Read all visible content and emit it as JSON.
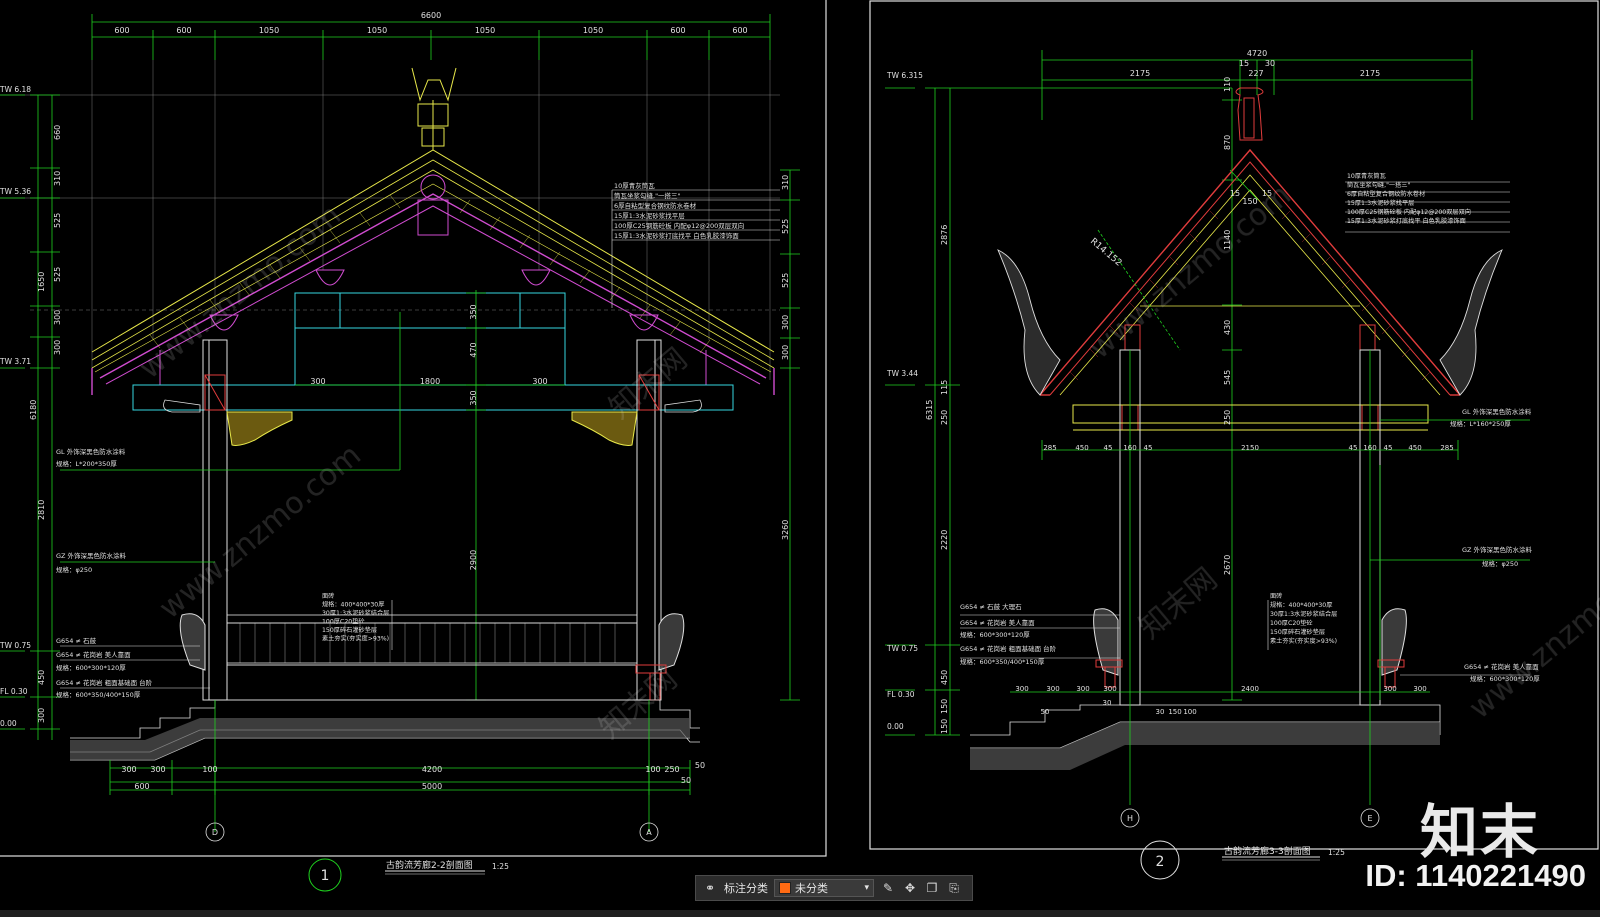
{
  "drawing_1": {
    "title": "古韵流芳廊2-2剖面图",
    "scale": "1:25",
    "number": "1",
    "top_dims": [
      "600",
      "600",
      "1050",
      "1050",
      "1050",
      "1050",
      "600",
      "600"
    ],
    "overall_top": "6600",
    "levels": [
      "TW 6.18",
      "TW 5.36",
      "TW 3.71",
      "TW 0.75",
      "FL 0.30",
      "0.00"
    ],
    "left_dims": [
      "660",
      "310",
      "525",
      "525",
      "300",
      "300",
      "1650",
      "6180",
      "2810",
      "450",
      "300"
    ],
    "right_dims": [
      "310",
      "525",
      "525",
      "300",
      "300",
      "3260"
    ],
    "inner_dims": [
      "300",
      "1800",
      "300",
      "350",
      "470",
      "350",
      "2900"
    ],
    "bottom_dims": [
      "300",
      "300",
      "100",
      "4200",
      "100",
      "250",
      "50",
      "600",
      "5000",
      "50"
    ],
    "grid_left": "D",
    "grid_right": "A",
    "note_roof": [
      "10厚青灰筒瓦",
      "筒瓦坐浆勾缝,\"一搭三\"",
      "6厚自粘型复合钢纹防水卷材",
      "15厚1:3水泥砂浆找平层",
      "100厚C25钢筋砼板  内配φ12@200双层双向",
      "15厚1:3水泥砂浆打底找平  白色乳胶漆饰面"
    ],
    "note_gl": [
      "GL  外饰深黑色防水涂料",
      "规格：L*200*350厚"
    ],
    "note_gz": [
      "GZ  外饰深黑色防水涂料",
      "规格：φ250"
    ],
    "note_floor": [
      "面砖",
      "规格：400*400*30厚",
      "30厚1:3水泥砂浆结合层",
      "100厚C20垫砼",
      "150厚碎石灌砂垫层",
      "素土夯实(夯实度>93%)"
    ],
    "note_stone": [
      "G654 ≠ 石鼓",
      "G654 ≠ 花岗岩  美人靠面",
      "规格：600*300*120厚",
      "G654 ≠ 花岗岩  粗面基础面  台阶",
      "规格：600*350/400*150厚"
    ]
  },
  "drawing_2": {
    "title": "古韵流芳廊3-3剖面图",
    "scale": "1:25",
    "number": "2",
    "overall_top": "4720",
    "top_dims": [
      "2175",
      "227",
      "2175",
      "30",
      "15"
    ],
    "levels": [
      "TW 6.315",
      "TW 3.44",
      "TW 0.75",
      "FL 0.30",
      "0.00"
    ],
    "left_dims": [
      "110",
      "870",
      "2876",
      "1140",
      "6315",
      "430",
      "545",
      "250",
      "115",
      "250",
      "2220",
      "2670",
      "450",
      "150",
      "150"
    ],
    "radius": "R14.152",
    "ridge_dims": [
      "15",
      "150",
      "15"
    ],
    "mid_dims": [
      "285",
      "450",
      "45",
      "160",
      "45",
      "2150",
      "45",
      "160",
      "45",
      "450",
      "285"
    ],
    "bottom_dims": [
      "300",
      "300",
      "300",
      "300",
      "2400",
      "300",
      "300",
      "50",
      "30",
      "30",
      "150",
      "100"
    ],
    "grid_left": "H",
    "grid_right": "E",
    "note_roof": [
      "10厚青灰筒瓦",
      "筒瓦坐浆勾缝,\"一搭三\"",
      "6厚自粘型复合钢纹防水卷材",
      "15厚1:3水泥砂浆找平层",
      "100厚C25钢筋砼板  内配φ12@200双层双向",
      "15厚1:3水泥砂浆打底找平  白色乳胶漆饰面"
    ],
    "note_gl": [
      "GL  外饰深黑色防水涂料",
      "规格：L*160*250厚"
    ],
    "note_gz": [
      "GZ  外饰深黑色防水涂料",
      "规格：φ250"
    ],
    "note_left": [
      "G654 ≠ 石鼓  大理石",
      "G654 ≠ 花岗岩  美人靠面",
      "规格：600*300*120厚",
      "G654 ≠ 花岗岩  粗面基础面  台阶",
      "规格：600*350/400*150厚"
    ],
    "note_floor": [
      "面砖",
      "规格：400*400*30厚",
      "30厚1:3水泥砂浆结合层",
      "100厚C20垫砼",
      "150厚碎石灌砂垫层",
      "素土夯实(夯实度>93%)"
    ],
    "note_right": [
      "G654 ≠ 花岗岩  美人靠面",
      "规格：600*300*120厚"
    ]
  },
  "watermarks": [
    "www.znzmo.com",
    "知末网"
  ],
  "brand": {
    "logo": "知末",
    "id": "ID: 1140221490"
  },
  "toolbar": {
    "label": "标注分类",
    "selected": "未分类"
  },
  "colors": {
    "bg": "#000000",
    "green": "#1fd11f",
    "yellow": "#e8e84a",
    "magenta": "#d04cd0",
    "cyan": "#36d6e0",
    "white": "#e0e0e0",
    "red": "#e03c3c",
    "orange": "#ff6a13"
  }
}
